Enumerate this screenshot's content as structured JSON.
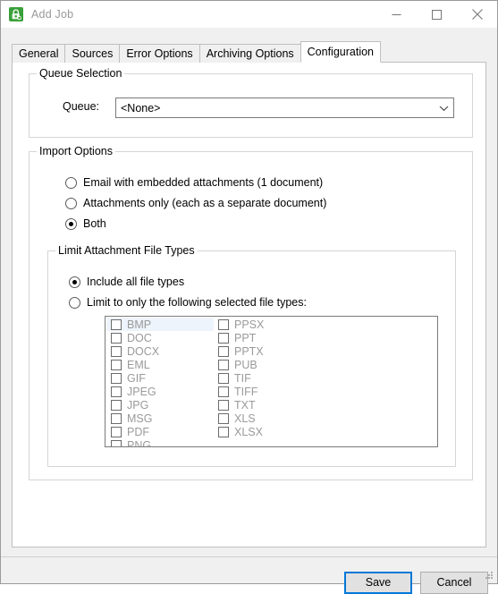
{
  "window": {
    "title": "Add Job",
    "icon": "app-lock-icon",
    "icon_color": "#3aa03a",
    "controls": {
      "minimize": "minimize-icon",
      "maximize": "maximize-icon",
      "close": "close-icon"
    }
  },
  "tabs": [
    {
      "label": "General",
      "active": false
    },
    {
      "label": "Sources",
      "active": false
    },
    {
      "label": "Error Options",
      "active": false
    },
    {
      "label": "Archiving Options",
      "active": false
    },
    {
      "label": "Configuration",
      "active": true
    }
  ],
  "queue_selection": {
    "group_title": "Queue Selection",
    "queue_label": "Queue:",
    "queue_value": "<None>",
    "dropdown_icon": "chevron-down-icon"
  },
  "import_options": {
    "group_title": "Import Options",
    "radios": [
      {
        "label": "Email with embedded attachments (1 document)",
        "checked": false
      },
      {
        "label": "Attachments only (each as a separate document)",
        "checked": false
      },
      {
        "label": "Both",
        "checked": true
      }
    ]
  },
  "limit_attachment_file_types": {
    "group_title": "Limit Attachment File Types",
    "radios": [
      {
        "label": "Include all file types",
        "checked": true
      },
      {
        "label": "Limit to only the following selected file types:",
        "checked": false
      }
    ],
    "file_types": {
      "enabled": false,
      "columns": [
        [
          {
            "label": "BMP",
            "checked": false,
            "selected": true
          },
          {
            "label": "DOC",
            "checked": false,
            "selected": false
          },
          {
            "label": "DOCX",
            "checked": false,
            "selected": false
          },
          {
            "label": "EML",
            "checked": false,
            "selected": false
          },
          {
            "label": "GIF",
            "checked": false,
            "selected": false
          },
          {
            "label": "JPEG",
            "checked": false,
            "selected": false
          },
          {
            "label": "JPG",
            "checked": false,
            "selected": false
          },
          {
            "label": "MSG",
            "checked": false,
            "selected": false
          },
          {
            "label": "PDF",
            "checked": false,
            "selected": false
          },
          {
            "label": "PNG",
            "checked": false,
            "selected": false
          }
        ],
        [
          {
            "label": "PPSX",
            "checked": false,
            "selected": false
          },
          {
            "label": "PPT",
            "checked": false,
            "selected": false
          },
          {
            "label": "PPTX",
            "checked": false,
            "selected": false
          },
          {
            "label": "PUB",
            "checked": false,
            "selected": false
          },
          {
            "label": "TIF",
            "checked": false,
            "selected": false
          },
          {
            "label": "TIFF",
            "checked": false,
            "selected": false
          },
          {
            "label": "TXT",
            "checked": false,
            "selected": false
          },
          {
            "label": "XLS",
            "checked": false,
            "selected": false
          },
          {
            "label": "XLSX",
            "checked": false,
            "selected": false
          }
        ]
      ]
    }
  },
  "footer": {
    "save_label": "Save",
    "cancel_label": "Cancel",
    "focus_color": "#0078d7"
  }
}
